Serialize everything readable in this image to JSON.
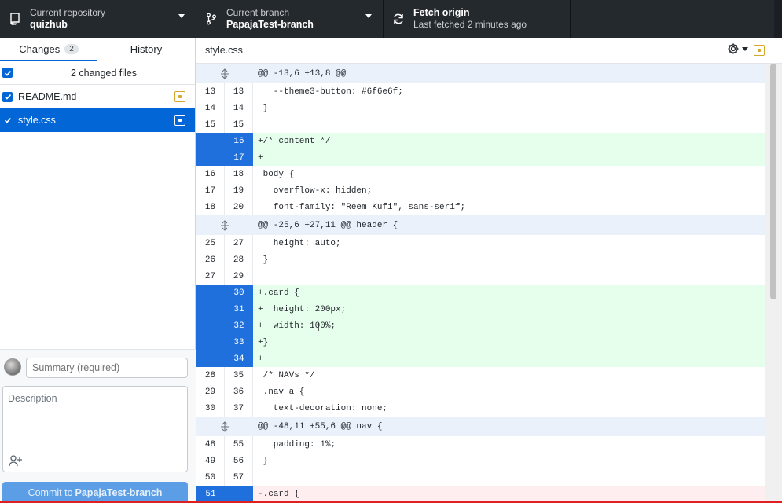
{
  "toolbar": {
    "repo": {
      "label": "Current repository",
      "value": "quizhub",
      "icon": "repo-icon"
    },
    "branch": {
      "label": "Current branch",
      "value": "PapajaTest-branch",
      "icon": "branch-icon"
    },
    "fetch": {
      "label": "Fetch origin",
      "value": "Last fetched 2 minutes ago",
      "icon": "sync-icon"
    }
  },
  "sidebar": {
    "tabs": [
      {
        "label": "Changes",
        "count": "2"
      },
      {
        "label": "History"
      }
    ],
    "changed_label": "2 changed files",
    "files": [
      {
        "name": "README.md",
        "status": "modified"
      },
      {
        "name": "style.css",
        "status": "modified",
        "selected": true
      }
    ]
  },
  "commit": {
    "summary_placeholder": "Summary (required)",
    "description_placeholder": "Description",
    "button_prefix": "Commit to",
    "button_branch": "PapajaTest-branch"
  },
  "diff": {
    "filename": "style.css",
    "lines": [
      {
        "type": "hunk",
        "code": "@@ -13,6 +13,8 @@"
      },
      {
        "type": "ctx",
        "old": "13",
        "new": "13",
        "code": "   --theme3-button: #6f6e6f;"
      },
      {
        "type": "ctx",
        "old": "14",
        "new": "14",
        "code": " }"
      },
      {
        "type": "ctx",
        "old": "15",
        "new": "15",
        "code": ""
      },
      {
        "type": "add",
        "old": "",
        "new": "16",
        "code": "+/* content */"
      },
      {
        "type": "add",
        "old": "",
        "new": "17",
        "code": "+"
      },
      {
        "type": "ctx",
        "old": "16",
        "new": "18",
        "code": " body {"
      },
      {
        "type": "ctx",
        "old": "17",
        "new": "19",
        "code": "   overflow-x: hidden;"
      },
      {
        "type": "ctx",
        "old": "18",
        "new": "20",
        "code": "   font-family: \"Reem Kufi\", sans-serif;"
      },
      {
        "type": "hunk",
        "code": "@@ -25,6 +27,11 @@ header {"
      },
      {
        "type": "ctx",
        "old": "25",
        "new": "27",
        "code": "   height: auto;"
      },
      {
        "type": "ctx",
        "old": "26",
        "new": "28",
        "code": " }"
      },
      {
        "type": "ctx",
        "old": "27",
        "new": "29",
        "code": ""
      },
      {
        "type": "add",
        "old": "",
        "new": "30",
        "code": "+.card {"
      },
      {
        "type": "add",
        "old": "",
        "new": "31",
        "code": "+  height: 200px;"
      },
      {
        "type": "add",
        "old": "",
        "new": "32",
        "code": "+  width: 100%;"
      },
      {
        "type": "add",
        "old": "",
        "new": "33",
        "code": "+}"
      },
      {
        "type": "add",
        "old": "",
        "new": "34",
        "code": "+"
      },
      {
        "type": "ctx",
        "old": "28",
        "new": "35",
        "code": " /* NAVs */"
      },
      {
        "type": "ctx",
        "old": "29",
        "new": "36",
        "code": " .nav a {"
      },
      {
        "type": "ctx",
        "old": "30",
        "new": "37",
        "code": "   text-decoration: none;"
      },
      {
        "type": "hunk",
        "code": "@@ -48,11 +55,6 @@ nav {"
      },
      {
        "type": "ctx",
        "old": "48",
        "new": "55",
        "code": "   padding: 1%;"
      },
      {
        "type": "ctx",
        "old": "49",
        "new": "56",
        "code": " }"
      },
      {
        "type": "ctx",
        "old": "50",
        "new": "57",
        "code": ""
      },
      {
        "type": "del",
        "old": "51",
        "new": "",
        "code": "-.card {"
      }
    ]
  }
}
